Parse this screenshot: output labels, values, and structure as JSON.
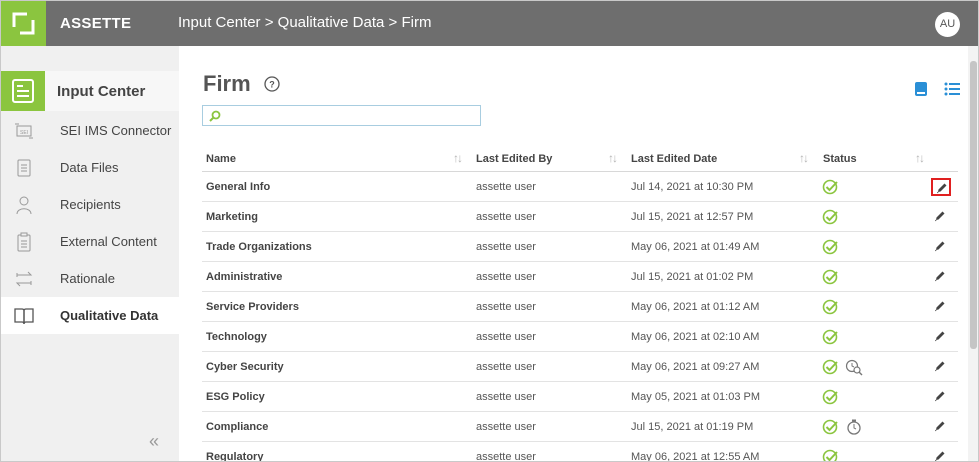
{
  "header": {
    "brand": "ASSETTE",
    "breadcrumb": "Input Center > Qualitative Data > Firm",
    "user_initials": "AU"
  },
  "sidebar": {
    "heading": "Input Center",
    "items": [
      {
        "label": "SEI IMS Connector",
        "icon": "connector-icon"
      },
      {
        "label": "Data Files",
        "icon": "file-icon"
      },
      {
        "label": "Recipients",
        "icon": "person-icon"
      },
      {
        "label": "External Content",
        "icon": "clipboard-icon"
      },
      {
        "label": "Rationale",
        "icon": "arrows-icon"
      },
      {
        "label": "Qualitative Data",
        "icon": "book-icon",
        "active": true
      }
    ],
    "collapse_glyph": "«"
  },
  "main": {
    "title": "Firm",
    "search": {
      "value": "",
      "placeholder": ""
    },
    "columns": [
      "Name",
      "Last Edited By",
      "Last Edited Date",
      "Status"
    ],
    "sort_glyph": "↑↓",
    "rows": [
      {
        "name": "General Info",
        "user": "assette user",
        "date": "Jul 14, 2021 at 10:30 PM",
        "extra": ""
      },
      {
        "name": "Marketing",
        "user": "assette user",
        "date": "Jul 15, 2021 at 12:57 PM",
        "extra": ""
      },
      {
        "name": "Trade Organizations",
        "user": "assette user",
        "date": "May 06, 2021 at 01:49 AM",
        "extra": ""
      },
      {
        "name": "Administrative",
        "user": "assette user",
        "date": "Jul 15, 2021 at 01:02 PM",
        "extra": ""
      },
      {
        "name": "Service Providers",
        "user": "assette user",
        "date": "May 06, 2021 at 01:12 AM",
        "extra": ""
      },
      {
        "name": "Technology",
        "user": "assette user",
        "date": "May 06, 2021 at 02:10 AM",
        "extra": ""
      },
      {
        "name": "Cyber Security",
        "user": "assette user",
        "date": "May 06, 2021 at 09:27 AM",
        "extra": "review-icon"
      },
      {
        "name": "ESG Policy",
        "user": "assette user",
        "date": "May 05, 2021 at 01:03 PM",
        "extra": ""
      },
      {
        "name": "Compliance",
        "user": "assette user",
        "date": "Jul 15, 2021 at 01:19 PM",
        "extra": "timer-icon"
      },
      {
        "name": "Regulatory",
        "user": "assette user",
        "date": "May 06, 2021 at 12:55 AM",
        "extra": ""
      }
    ]
  },
  "colors": {
    "accent": "#8bc53f",
    "topbar": "#6e6e6e",
    "link": "#2a8fd6",
    "highlight": "#e02020"
  }
}
